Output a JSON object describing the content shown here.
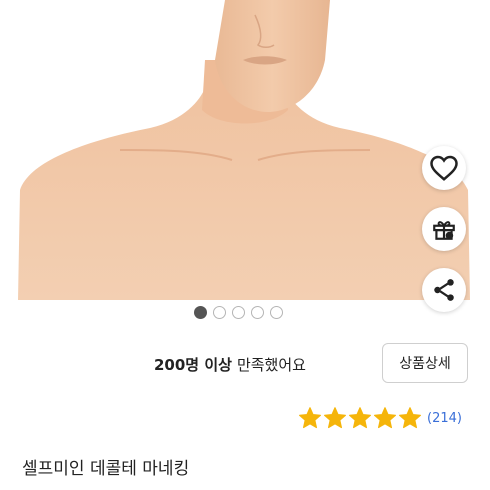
{
  "product": {
    "title": "셀프미인 데콜테 마네킹",
    "satisfaction_count": "200명 이상",
    "satisfaction_text": "만족했어요",
    "detail_button_label": "상품상세",
    "rating": 5,
    "review_count": "(214)",
    "image_pages": 5,
    "current_image_page": 1
  },
  "actions": {
    "like_icon": "heart-icon",
    "gift_icon": "gift-icon",
    "share_icon": "share-icon"
  },
  "colors": {
    "star": "#f5b50a",
    "review_link": "#3a6fd8",
    "skin": "#f1c7a6"
  }
}
